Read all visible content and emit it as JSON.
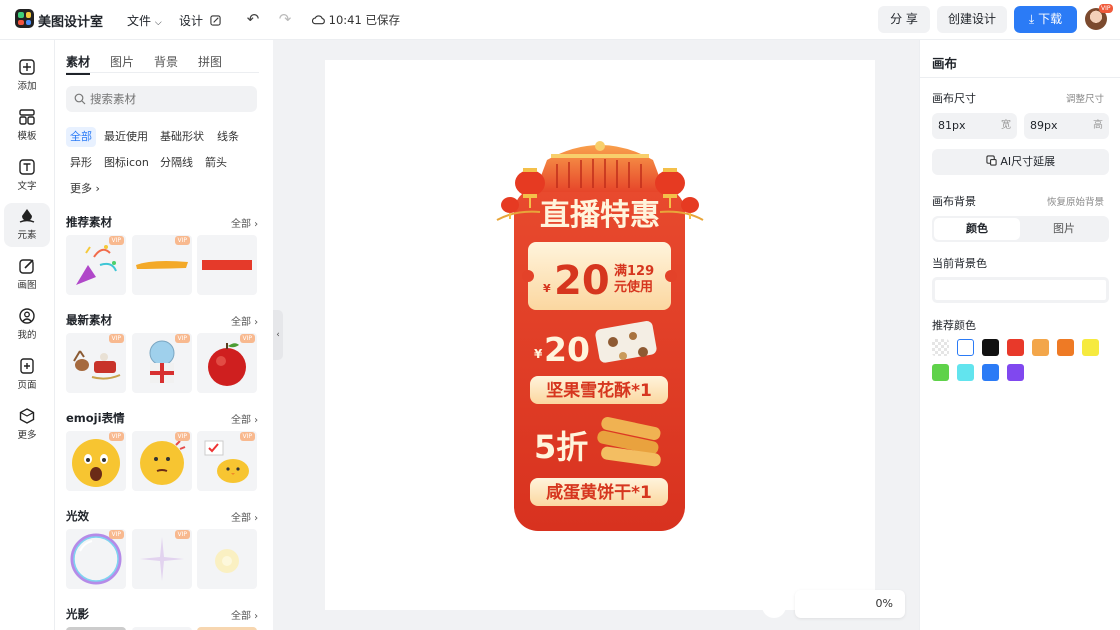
{
  "app": {
    "name": "美图设计室"
  },
  "topbar": {
    "menu_file": "文件",
    "menu_design": "设计",
    "save_status": "10:41 已保存",
    "share_label": "分 享",
    "create_label": "创建设计",
    "download_label": "下载",
    "avatar_vip": "VIP"
  },
  "rail": [
    {
      "label": "添加",
      "icon": "add-icon"
    },
    {
      "label": "模板",
      "icon": "template-icon"
    },
    {
      "label": "文字",
      "icon": "text-icon"
    },
    {
      "label": "元素",
      "icon": "element-icon",
      "active": true
    },
    {
      "label": "画图",
      "icon": "draw-icon"
    },
    {
      "label": "我的",
      "icon": "user-icon"
    },
    {
      "label": "页面",
      "icon": "page-icon"
    },
    {
      "label": "更多",
      "icon": "more-icon"
    }
  ],
  "panel": {
    "tabs": [
      "素材",
      "图片",
      "背景",
      "拼图"
    ],
    "search_placeholder": "搜索素材",
    "chips": [
      "全部",
      "最近使用",
      "基础形状",
      "线条",
      "异形",
      "图标icon",
      "分隔线",
      "箭头",
      "更多"
    ],
    "vip": "VIP",
    "all_label": "全部",
    "sections": [
      "推荐素材",
      "最新素材",
      "emoji表情",
      "光效",
      "光影"
    ]
  },
  "canvas": {
    "zoom": "0%",
    "poster": {
      "title": "直播特惠",
      "coupon_currency": "¥",
      "coupon_value": "20",
      "coupon_cond_1": "满129",
      "coupon_cond_2": "元使用",
      "item1_currency": "¥",
      "item1_price": "20",
      "item1_name": "坚果雪花酥*1",
      "item2_price": "5折",
      "item2_name": "咸蛋黄饼干*1"
    }
  },
  "right_panel": {
    "title": "画布",
    "size_label": "画布尺寸",
    "size_link": "调整尺寸",
    "width_value": "81px",
    "width_unit": "宽",
    "height_value": "89px",
    "height_unit": "高",
    "ai_button": "AI尺寸延展",
    "bg_label": "画布背景",
    "bg_reset": "恢复原始背景",
    "seg_color": "颜色",
    "seg_image": "图片",
    "current_bg": "当前背景色",
    "recommend": "推荐颜色",
    "swatches": [
      "transparent",
      "#ffffff",
      "#111111",
      "#e8392a",
      "#f3a64a",
      "#ee7a25",
      "#f6ea3f",
      "#5fd24a",
      "#62e4ee",
      "#2b7bf6",
      "#8048ef"
    ]
  }
}
